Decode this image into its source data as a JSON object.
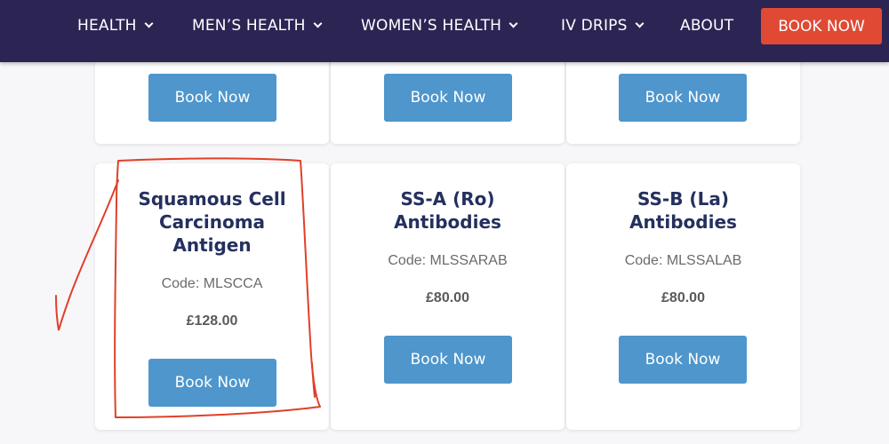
{
  "nav": {
    "items": [
      {
        "label": "HEALTH",
        "has_dropdown": true
      },
      {
        "label": "MEN’S HEALTH",
        "has_dropdown": true
      },
      {
        "label": "WOMEN’S HEALTH",
        "has_dropdown": true
      },
      {
        "label": "IV DRIPS",
        "has_dropdown": true
      },
      {
        "label": "ABOUT",
        "has_dropdown": false
      }
    ],
    "book_label": "BOOK NOW"
  },
  "top_row": {
    "cards": [
      {
        "button_label": "Book Now"
      },
      {
        "button_label": "Book Now"
      },
      {
        "button_label": "Book Now"
      }
    ]
  },
  "bottom_row": {
    "cards": [
      {
        "title_lines": [
          "Squamous Cell",
          "Carcinoma",
          "Antigen"
        ],
        "code": "Code: MLSCCA",
        "price": "£128.00",
        "button_label": "Book Now",
        "highlighted": true
      },
      {
        "title_lines": [
          "SS-A (Ro)",
          "Antibodies"
        ],
        "code": "Code: MLSSARAB",
        "price": "£80.00",
        "button_label": "Book Now",
        "highlighted": false
      },
      {
        "title_lines": [
          "SS-B (La)",
          "Antibodies"
        ],
        "code": "Code: MLSSALAB",
        "price": "£80.00",
        "button_label": "Book Now",
        "highlighted": false
      }
    ]
  },
  "colors": {
    "navbar": "#2c2554",
    "book_nav": "#e04a34",
    "button": "#4e96cc",
    "title": "#24305e",
    "annotation": "#e0402a"
  }
}
